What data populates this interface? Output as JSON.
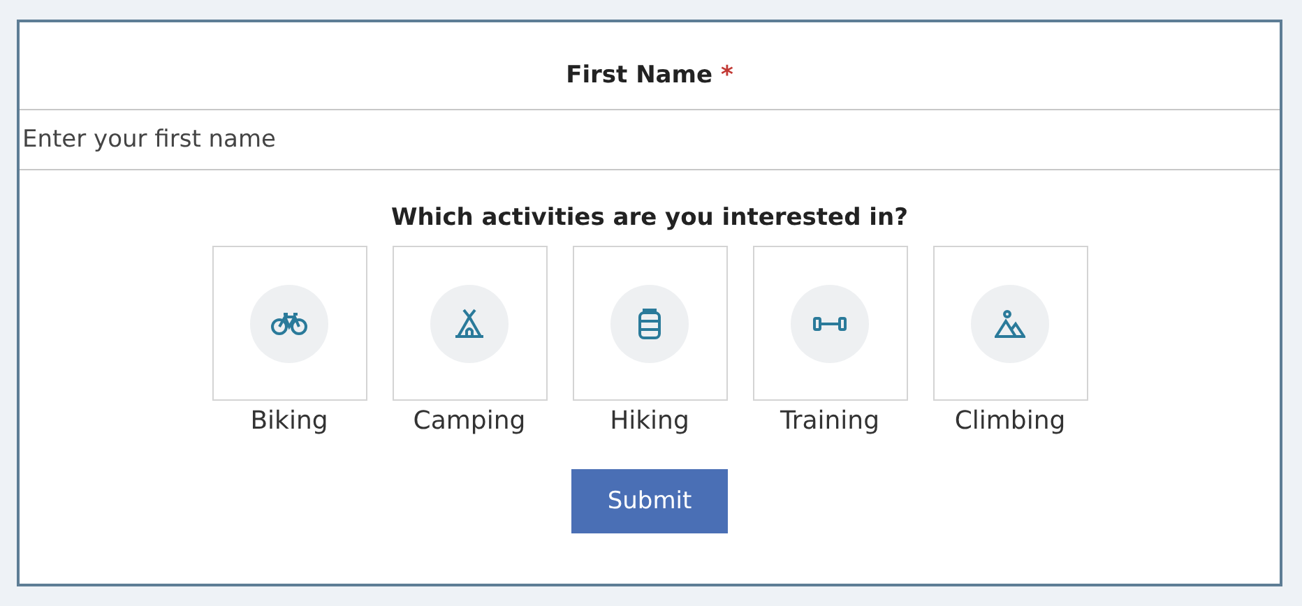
{
  "field": {
    "label": "First Name",
    "required_mark": "*",
    "placeholder": "Enter your first name"
  },
  "question": "Which activities are you interested in?",
  "activities": [
    {
      "label": "Biking"
    },
    {
      "label": "Camping"
    },
    {
      "label": "Hiking"
    },
    {
      "label": "Training"
    },
    {
      "label": "Climbing"
    }
  ],
  "submit": "Submit"
}
